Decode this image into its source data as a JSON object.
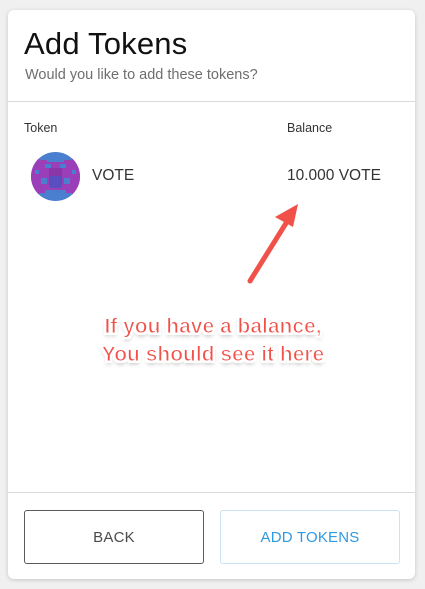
{
  "header": {
    "title": "Add Tokens",
    "subtitle": "Would you like to add these tokens?"
  },
  "table": {
    "columns": [
      "Token",
      "Balance"
    ],
    "rows": [
      {
        "symbol": "VOTE",
        "balance": "10.000 VOTE",
        "icon": "identicon-icon"
      }
    ]
  },
  "annotation": {
    "line1": "If you have a balance,",
    "line2": "You should see it here",
    "color": "#f0524a"
  },
  "footer": {
    "back_label": "BACK",
    "add_label": "ADD TOKENS"
  },
  "colors": {
    "accent": "#2f9ae0",
    "identicon_purple": "#9b3fb8",
    "identicon_blue": "#4a7fd0"
  }
}
